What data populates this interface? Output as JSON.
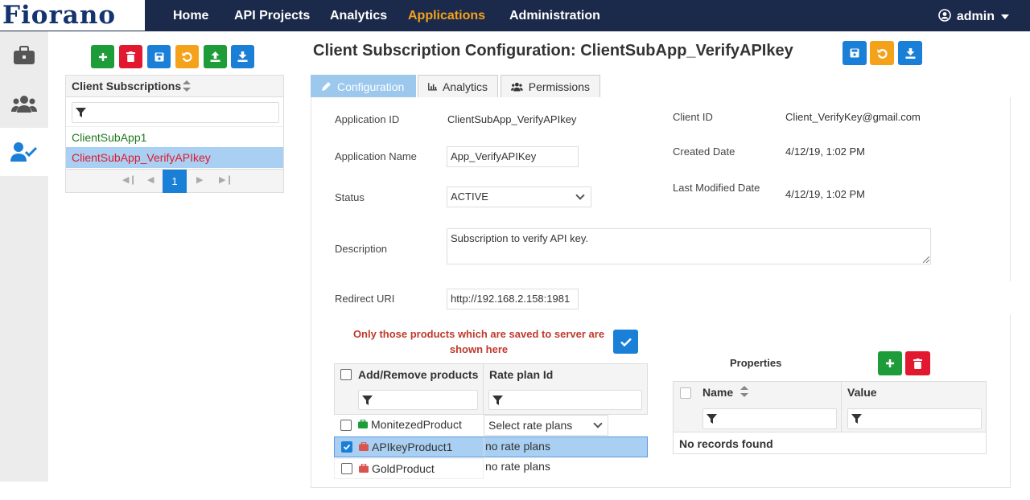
{
  "brand": {
    "logo": "Fiorano"
  },
  "nav": {
    "items": [
      "Home",
      "API Projects",
      "Analytics",
      "Applications",
      "Administration"
    ],
    "active": "Applications"
  },
  "user": {
    "name": "admin"
  },
  "sidebar": {
    "icons": [
      "briefcase-icon",
      "users-icon",
      "user-check-icon"
    ]
  },
  "left_panel": {
    "header": "Client Subscriptions",
    "rows": [
      "ClientSubApp1",
      "ClientSubApp_VerifyAPIkey"
    ],
    "page": "1"
  },
  "main": {
    "title": "Client Subscription Configuration: ClientSubApp_VerifyAPIkey",
    "tabs": [
      "Configuration",
      "Analytics",
      "Permissions"
    ],
    "fields": {
      "app_id_label": "Application ID",
      "app_id": "ClientSubApp_VerifyAPIkey",
      "app_name_label": "Application Name",
      "app_name": "App_VerifyAPIKey",
      "status_label": "Status",
      "status": "ACTIVE",
      "desc_label": "Description",
      "desc": "Subscription to verify API key.",
      "redirect_label": "Redirect URI",
      "redirect": "http://192.168.2.158:1981",
      "client_id_label": "Client ID",
      "client_id": "Client_VerifyKey@gmail.com",
      "created_label": "Created Date",
      "created": "4/12/19, 1:02 PM",
      "modified_label": "Last Modified Date",
      "modified": "4/12/19, 1:02 PM"
    },
    "notice": "Only those products which are saved to server are shown here",
    "products": {
      "headers": [
        "Add/Remove products",
        "Rate plan Id"
      ],
      "rows": [
        {
          "name": "MonitezedProduct",
          "rate": "Select rate plans"
        },
        {
          "name": "APIkeyProduct1",
          "rate": "no rate plans"
        },
        {
          "name": "GoldProduct",
          "rate": "no rate plans"
        }
      ]
    },
    "properties": {
      "title": "Properties",
      "headers": [
        "Name",
        "Value"
      ],
      "empty": "No records found"
    }
  },
  "colors": {
    "nav_bg": "#1b2a4a",
    "accent": "#f5a21b",
    "primary": "#1a7fd6",
    "green": "#1e9c3a",
    "red": "#e1182e"
  }
}
